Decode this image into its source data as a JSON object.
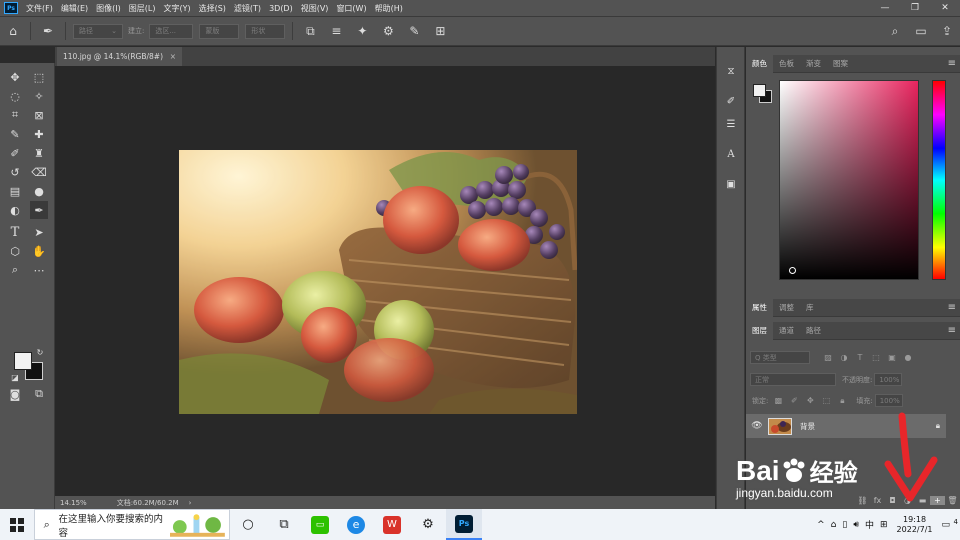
{
  "app": {
    "logo_text": "Ps"
  },
  "menu": [
    "文件(F)",
    "编辑(E)",
    "图像(I)",
    "图层(L)",
    "文字(Y)",
    "选择(S)",
    "滤镜(T)",
    "3D(D)",
    "视图(V)",
    "窗口(W)",
    "帮助(H)"
  ],
  "window_controls": {
    "minimize": "—",
    "restore": "❐",
    "close": "✕"
  },
  "options": {
    "mode_value": "路径",
    "make_label": "建立:",
    "selection_btn": "选区...",
    "mask_btn": "蒙版",
    "shape_btn": "形状"
  },
  "document": {
    "tab_title": "110.jpg @ 14.1%(RGB/8#)",
    "tab_close": "×",
    "zoom": "14.15%",
    "doc_info": "文档:60.2M/60.2M",
    "status_arrow": "›"
  },
  "color_panel": {
    "tabs": [
      "颜色",
      "色板",
      "渐变",
      "图案"
    ],
    "fg_color": "#f2f2f2",
    "bg_color": "#111111"
  },
  "properties_panel": {
    "tabs": [
      "属性",
      "调整",
      "库"
    ]
  },
  "layers_panel": {
    "tabs": [
      "图层",
      "通道",
      "路径"
    ],
    "filter_value": "Q 类型",
    "blend_mode": "正常",
    "opacity_label": "不透明度:",
    "opacity_value": "100%",
    "lock_label": "锁定:",
    "fill_label": "填充:",
    "fill_value": "100%",
    "layers": [
      {
        "name": "背景",
        "visible": true,
        "locked": true
      }
    ]
  },
  "taskbar": {
    "search_placeholder": "在这里输入你要搜索的内容",
    "ime": "中",
    "time": "19:18",
    "date": "2022/7/1",
    "notification_count": "4"
  },
  "watermark": {
    "brand": "Bai",
    "brand_cn": "经验",
    "url": "jingyan.baidu.com"
  },
  "colors": {
    "ui_dark": "#535353",
    "canvas_bg": "#282828",
    "accent_ps": "#31a8ff",
    "annotation_red": "#e8262a"
  }
}
